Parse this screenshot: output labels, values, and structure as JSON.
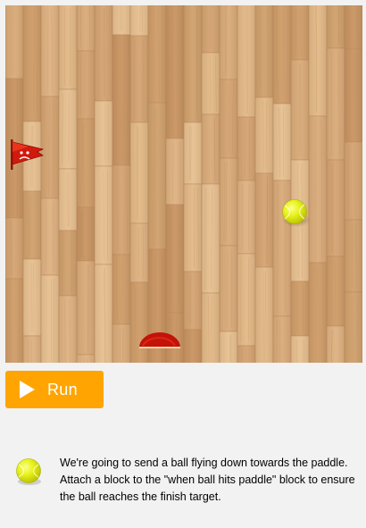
{
  "run_button": {
    "label": "Run",
    "icon": "play-icon",
    "color": "#ffa400"
  },
  "game": {
    "floor": "wood-parquet",
    "elements": [
      {
        "name": "finish-flag",
        "icon": "flag-icon",
        "color": "#d11a0e"
      },
      {
        "name": "ball",
        "icon": "tennis-ball-icon",
        "color": "#e6ef1a"
      },
      {
        "name": "paddle",
        "icon": "semicircle-paddle-icon",
        "color": "#c41208"
      }
    ]
  },
  "instructions": {
    "avatar_icon": "tennis-ball-icon",
    "text": "We're going to send a ball flying down towards the paddle. Attach a block to the \"when ball hits paddle\" block to ensure the ball reaches the finish target."
  }
}
